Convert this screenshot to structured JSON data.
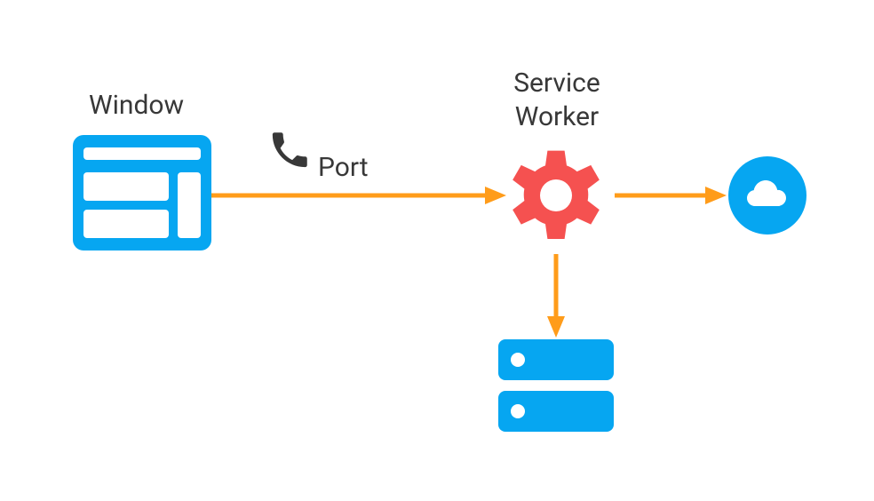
{
  "labels": {
    "window": "Window",
    "port": "Port",
    "service_worker": "Service\nWorker"
  },
  "colors": {
    "blue": "#06A6F1",
    "orange": "#FF9C1A",
    "red": "#F55150",
    "dark": "#383838",
    "white": "#FFFFFF"
  },
  "nodes": [
    {
      "id": "window",
      "label_key": "window",
      "icon": "browser-window",
      "color": "blue"
    },
    {
      "id": "port",
      "label_key": "port",
      "icon": "phone",
      "color": "dark"
    },
    {
      "id": "sw",
      "label_key": "service_worker",
      "icon": "gear",
      "color": "red"
    },
    {
      "id": "cache",
      "label_key": null,
      "icon": "cache-drives",
      "color": "blue"
    },
    {
      "id": "cloud",
      "label_key": null,
      "icon": "cloud-circle",
      "color": "blue"
    }
  ],
  "edges": [
    {
      "from": "window",
      "to": "sw",
      "color": "orange"
    },
    {
      "from": "sw",
      "to": "cloud",
      "color": "orange"
    },
    {
      "from": "sw",
      "to": "cache",
      "color": "orange"
    }
  ]
}
